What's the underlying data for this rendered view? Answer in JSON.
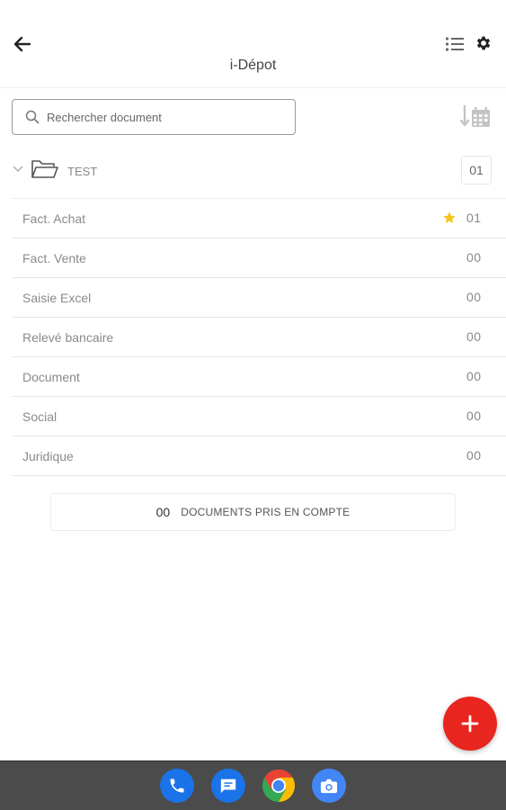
{
  "header": {
    "title": "i-Dépot",
    "back_icon": "arrow-left-icon",
    "list_icon": "list-icon",
    "settings_icon": "gear-icon"
  },
  "search": {
    "placeholder": "Rechercher document",
    "value": ""
  },
  "sort_icon": "sort-calendar-icon",
  "folder": {
    "name": "TEST",
    "count": "01",
    "expanded": true
  },
  "categories": [
    {
      "label": "Fact. Achat",
      "count": "01",
      "starred": true
    },
    {
      "label": "Fact. Vente",
      "count": "00",
      "starred": false
    },
    {
      "label": "Saisie Excel",
      "count": "00",
      "starred": false
    },
    {
      "label": "Relevé bancaire",
      "count": "00",
      "starred": false
    },
    {
      "label": "Document",
      "count": "00",
      "starred": false
    },
    {
      "label": "Social",
      "count": "00",
      "starred": false
    },
    {
      "label": "Juridique",
      "count": "00",
      "starred": false
    }
  ],
  "summary": {
    "count": "00",
    "label": "DOCUMENTS PRIS EN COMPTE"
  },
  "fab_icon": "plus-icon",
  "colors": {
    "accent": "#e8261f",
    "star": "#f5c518",
    "taskbar": "#4b4b4b",
    "phone_app": "#1a73e8",
    "messages_app": "#1a73e8",
    "camera_app": "#4285f4"
  },
  "dock": [
    {
      "name": "phone-app",
      "icon": "phone-icon"
    },
    {
      "name": "messages-app",
      "icon": "message-icon"
    },
    {
      "name": "chrome-app",
      "icon": "chrome-icon"
    },
    {
      "name": "camera-app",
      "icon": "camera-icon"
    }
  ]
}
